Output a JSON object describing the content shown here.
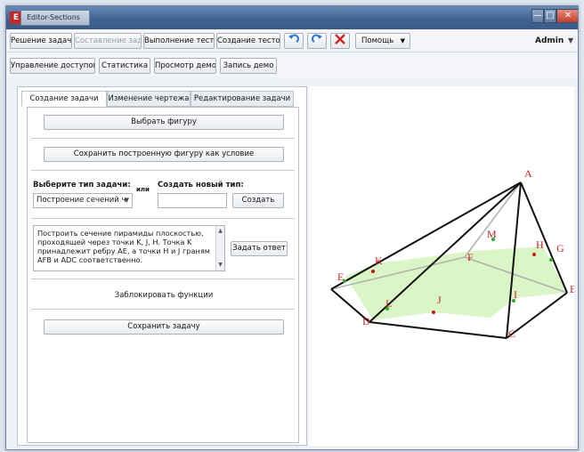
{
  "window": {
    "app_icon": "Е",
    "title": "Editor-Sections",
    "min_glyph": "—",
    "max_glyph": "□",
    "close_glyph": "✕"
  },
  "toolbar": {
    "create_task": "Решение задач",
    "compose_task": "Составление задач",
    "run_test": "Выполнение теста",
    "create_tests": "Создание тестов",
    "undo_icon": "undo-arrow-icon",
    "redo_icon": "redo-arrow-icon",
    "delete_icon": "red-x-icon",
    "help": "Помощь",
    "user": "Admin",
    "access": "Управление доступом",
    "statistics": "Статистика",
    "view_demo": "Просмотр демо",
    "record_demo": "Запись демо"
  },
  "tabs": [
    "Создание задачи",
    "Изменение чертежа",
    "Редактирование задачи"
  ],
  "panel": {
    "choose_figure": "Выбрать фигуру",
    "save_figure": "Сохранить построенную фигуру как условие",
    "task_type_label": "Выберите тип задачи:",
    "or_label": "или",
    "new_type_label": "Создать новый тип:",
    "task_type_value": "Построение сечений ч",
    "create_button": "Создать",
    "task_text": "Построить сечение пирамиды плоскостью, проходящей через точки K, J, H. Точка K принадлежит ребру AE, а точки H и J граням AFB и ADC соответственно.",
    "set_answer": "Задать ответ",
    "lock_functions": "Заблокировать функции",
    "save_task": "Сохранить задачу"
  },
  "figure": {
    "labels": [
      "A",
      "B",
      "C",
      "D",
      "E",
      "F",
      "G",
      "H",
      "I",
      "J",
      "K",
      "L",
      "M"
    ],
    "colors": {
      "label": "#cc2020",
      "edge": "#111111",
      "hidden": "#b0b0b0",
      "section": "#d6f5c0",
      "point_green": "#2eaa2e",
      "point_red": "#cc1010"
    }
  }
}
